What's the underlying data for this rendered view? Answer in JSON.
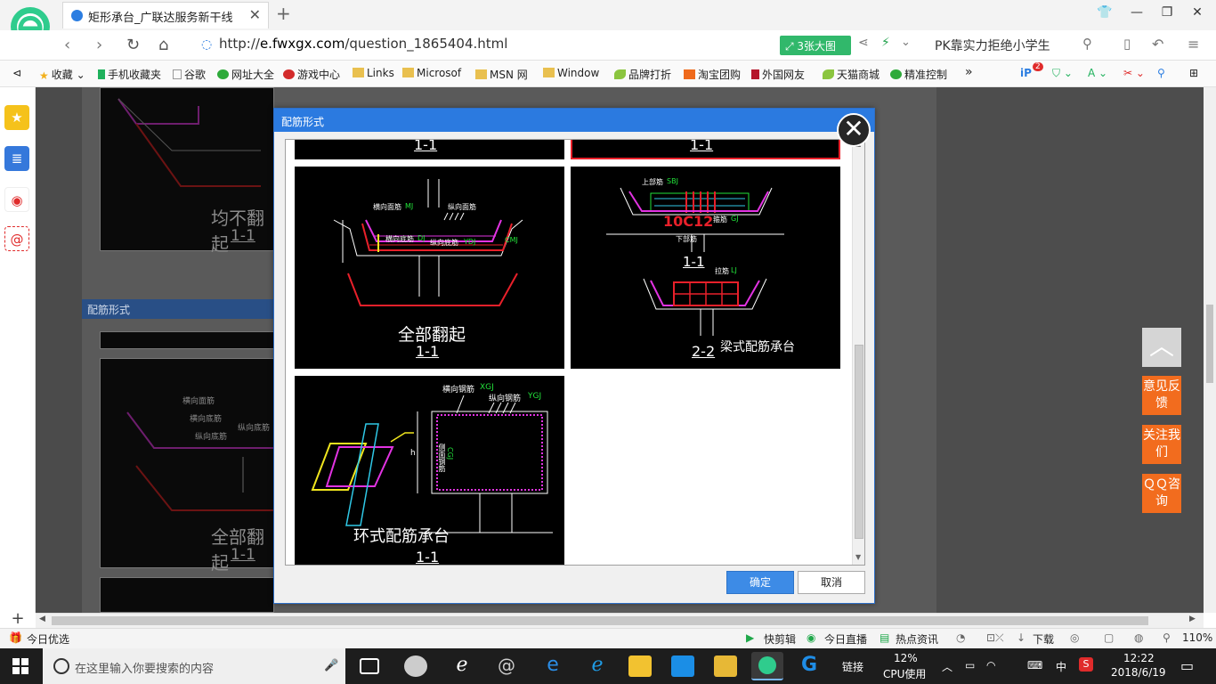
{
  "browser": {
    "tab_title": "矩形承台_广联达服务新干线",
    "url_prefix": "http://",
    "url_domain": "e.fwxgx.com",
    "url_path": "/question_1865404.html",
    "big_image_badge": "3张大图",
    "search_suggestion": "PK靠实力拒绝小学生",
    "bookmarks": [
      "收藏",
      "手机收藏夹",
      "谷歌",
      "网址大全",
      "游戏中心",
      "Links",
      "Microsof",
      "MSN 网",
      "Window",
      "品牌打折",
      "淘宝团购",
      "外国网友",
      "天猫商城",
      "精准控制"
    ],
    "more": "»",
    "badge_count": "2",
    "status_left": "今日优选",
    "status_items": [
      "快剪辑",
      "今日直播",
      "热点资讯",
      "下载"
    ],
    "zoom": "110%"
  },
  "page": {
    "section_title": "配筋形式",
    "bg_labels": {
      "top_caption": "均不翻起",
      "section_1_1": "1-1",
      "lower_caption": "全部翻起",
      "lower_section": "1-1",
      "rebar_labels": [
        "横向面筋",
        "纵向底筋",
        "横向底筋",
        "纵向底筋"
      ]
    },
    "float_buttons": {
      "back_to_top": "︿",
      "feedback": "意见反馈",
      "follow": "关注我们",
      "qq": "ＱＱ咨询"
    }
  },
  "dialog": {
    "title": "配筋形式",
    "close": "✕",
    "ok": "确定",
    "cancel": "取消",
    "cards": {
      "top_left_label": "1-1",
      "top_right_label": "1-1",
      "full_flip": {
        "caption": "全部翻起",
        "section": "1-1",
        "labels": [
          "横向面筋",
          "MJ",
          "纵向面筋",
          "横向底筋",
          "DJ",
          "纵向底筋",
          "YDJ",
          "CMJ"
        ]
      },
      "beam_type": {
        "caption": "梁式配筋承台",
        "section_top": "1-1",
        "section_bottom": "2-2",
        "labels": [
          "上部筋",
          "SBJ",
          "10C12",
          "下部筋",
          "箍筋",
          "GJ",
          "拉筋",
          "LJ"
        ]
      },
      "ring_type": {
        "caption": "环式配筋承台",
        "section": "1-1",
        "labels": [
          "横向钢筋",
          "XGJ",
          "纵向钢筋",
          "YGJ",
          "侧面钢筋",
          "CGJ",
          "h"
        ]
      }
    }
  },
  "taskbar": {
    "search_placeholder": "在这里输入你要搜索的内容",
    "links": "链接",
    "cpu_percent": "12%",
    "cpu_label": "CPU使用",
    "ime": "中",
    "time": "12:22",
    "date": "2018/6/19"
  },
  "colors": {
    "dialog_title": "#2b7ae0",
    "ok_button": "#3d8be6",
    "float_orange": "#f26c1e",
    "rebar_red": "#e8202a",
    "rebar_magenta": "#e233e2",
    "rebar_yellow": "#f0e61e",
    "label_green": "#22e23a"
  }
}
